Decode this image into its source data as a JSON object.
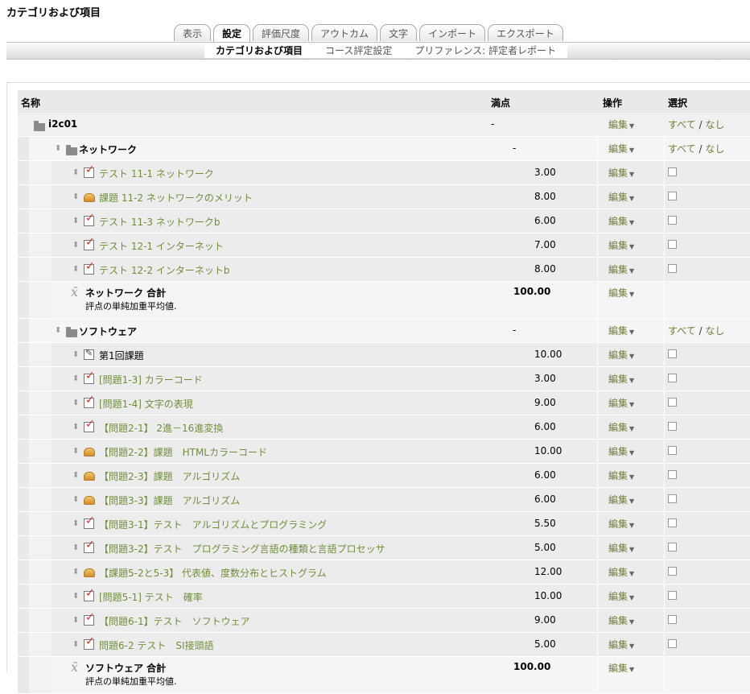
{
  "page": {
    "title": "カテゴリおよび項目"
  },
  "tabs": [
    {
      "label": "表示"
    },
    {
      "label": "設定",
      "active": true
    },
    {
      "label": "評価尺度"
    },
    {
      "label": "アウトカム"
    },
    {
      "label": "文字"
    },
    {
      "label": "インポート"
    },
    {
      "label": "エクスポート"
    }
  ],
  "subtabs": [
    {
      "label": "カテゴリおよび項目",
      "active": true
    },
    {
      "label": "コース評定設定"
    },
    {
      "label": "プリファレンス: 評定者レポート"
    }
  ],
  "table": {
    "headers": {
      "name": "名称",
      "max": "満点",
      "actions": "操作",
      "select": "選択"
    },
    "edit_label": "編集",
    "select_all": "すべて",
    "select_sep": " / ",
    "select_none": "なし",
    "rows": [
      {
        "type": "course",
        "name": "i2c01",
        "max": "-"
      },
      {
        "type": "category",
        "name": "ネットワーク",
        "max": "-"
      },
      {
        "type": "item",
        "icon": "quiz",
        "name": "テスト 11-1 ネットワーク",
        "max": "3.00"
      },
      {
        "type": "item",
        "icon": "assign",
        "name": "課題 11-2 ネットワークのメリット",
        "max": "8.00"
      },
      {
        "type": "item",
        "icon": "quiz",
        "name": "テスト 11-3 ネットワークb",
        "max": "6.00"
      },
      {
        "type": "item",
        "icon": "quiz",
        "name": "テスト 12-1 インターネット",
        "max": "7.00"
      },
      {
        "type": "item",
        "icon": "quiz",
        "name": "テスト 12-2 インターネットb",
        "max": "8.00"
      },
      {
        "type": "total",
        "name": "ネットワーク 合計",
        "desc": "評点の単純加重平均値.",
        "max": "100.00"
      },
      {
        "type": "category",
        "name": "ソフトウェア",
        "max": "-"
      },
      {
        "type": "item",
        "icon": "manual",
        "name": "第1回課題",
        "max": "10.00",
        "plain": true
      },
      {
        "type": "item",
        "icon": "quiz",
        "name": "[問題1-3] カラーコード",
        "max": "3.00"
      },
      {
        "type": "item",
        "icon": "quiz",
        "name": "[問題1-4] 文字の表現",
        "max": "9.00"
      },
      {
        "type": "item",
        "icon": "quiz",
        "name": "【問題2-1】 2進－16進変換",
        "max": "6.00"
      },
      {
        "type": "item",
        "icon": "assign",
        "name": "【問題2-2】課題　HTMLカラーコード",
        "max": "10.00"
      },
      {
        "type": "item",
        "icon": "assign",
        "name": "【問題2-3】課題　アルゴリズム",
        "max": "6.00"
      },
      {
        "type": "item",
        "icon": "assign",
        "name": "【問題3-3】課題　アルゴリズム",
        "max": "6.00"
      },
      {
        "type": "item",
        "icon": "quiz",
        "name": "【問題3-1】テスト　アルゴリズムとプログラミング",
        "max": "5.50"
      },
      {
        "type": "item",
        "icon": "quiz",
        "name": "【問題3-2】テスト　プログラミング言語の種類と言語プロセッサ",
        "max": "5.00"
      },
      {
        "type": "item",
        "icon": "assign",
        "name": "【課題5-2と5-3】 代表値、度数分布とヒストグラム",
        "max": "12.00"
      },
      {
        "type": "item",
        "icon": "quiz",
        "name": "[問題5-1] テスト　確率",
        "max": "10.00"
      },
      {
        "type": "item",
        "icon": "quiz",
        "name": "【問題6-1】テスト　ソフトウェア",
        "max": "9.00"
      },
      {
        "type": "item",
        "icon": "quiz",
        "name": "問題6-2 テスト　SI接頭語",
        "max": "5.00"
      },
      {
        "type": "total",
        "name": "ソフトウェア 合計",
        "desc": "評点の単純加重平均値.",
        "max": "100.00"
      }
    ]
  }
}
